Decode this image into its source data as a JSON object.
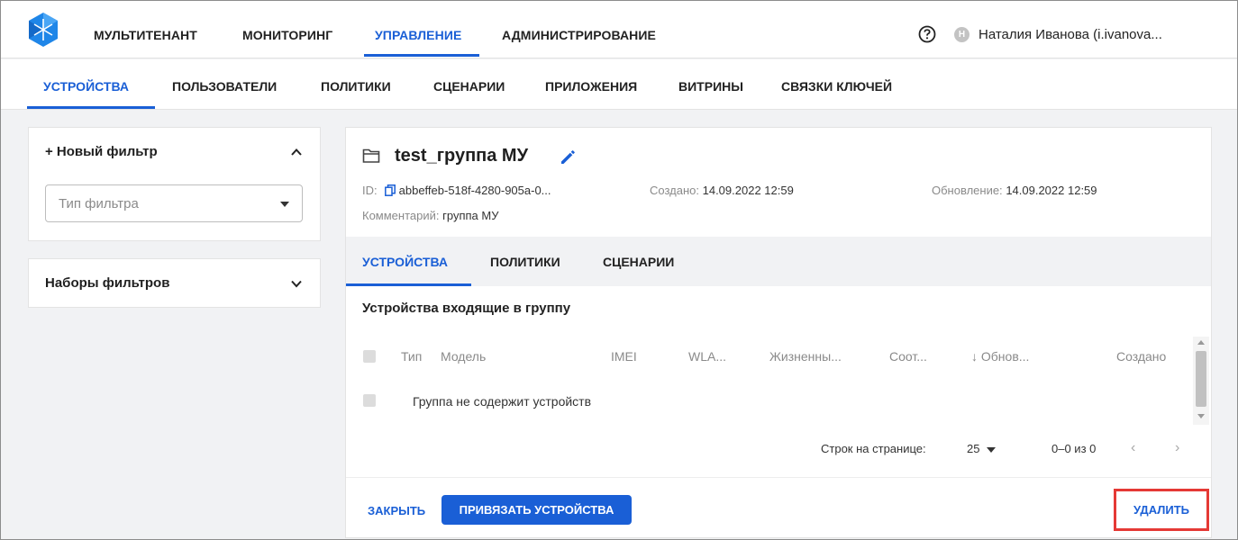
{
  "topnav": {
    "items": [
      "МУЛЬТИТЕНАНТ",
      "МОНИТОРИНГ",
      "УПРАВЛЕНИЕ",
      "АДМИНИСТРИРОВАНИЕ"
    ],
    "active": "УПРАВЛЕНИЕ",
    "avatar_letter": "Н",
    "user": "Наталия Иванова (i.ivanova..."
  },
  "subnav": {
    "items": [
      "УСТРОЙСТВА",
      "ПОЛЬЗОВАТЕЛИ",
      "ПОЛИТИКИ",
      "СЦЕНАРИИ",
      "ПРИЛОЖЕНИЯ",
      "ВИТРИНЫ",
      "СВЯЗКИ КЛЮЧЕЙ"
    ],
    "active": "УСТРОЙСТВА"
  },
  "filters": {
    "new_filter": "+ Новый фильтр",
    "type_placeholder": "Тип фильтра",
    "sets_title": "Наборы фильтров"
  },
  "group": {
    "title": "test_группа МУ",
    "id_label": "ID:",
    "id_value": "abbeffeb-518f-4280-905a-0...",
    "created_label": "Создано:",
    "created_value": "14.09.2022 12:59",
    "updated_label": "Обновление:",
    "updated_value": "14.09.2022 12:59",
    "comment_label": "Комментарий:",
    "comment_value": "группа МУ"
  },
  "tabs": [
    "УСТРОЙСТВА",
    "ПОЛИТИКИ",
    "СЦЕНАРИИ"
  ],
  "active_tab": "УСТРОЙСТВА",
  "devices": {
    "section_title": "Устройства входящие в группу",
    "columns": [
      "Тип",
      "Модель",
      "IMEI",
      "WLA...",
      "Жизненны...",
      "Соот...",
      "↓ Обнов...",
      "Создано"
    ],
    "empty_text": "Группа не содержит устройств"
  },
  "pagination": {
    "rows_label": "Строк на странице:",
    "rows_value": "25",
    "range": "0–0 из 0",
    "prev": "‹",
    "next": "›"
  },
  "actions": {
    "close": "ЗАКРЫТЬ",
    "bind": "ПРИВЯЗАТЬ УСТРОЙСТВА",
    "delete": "УДАЛИТЬ"
  },
  "colors": {
    "accent": "#1a5fd6",
    "highlight": "#e53935"
  }
}
